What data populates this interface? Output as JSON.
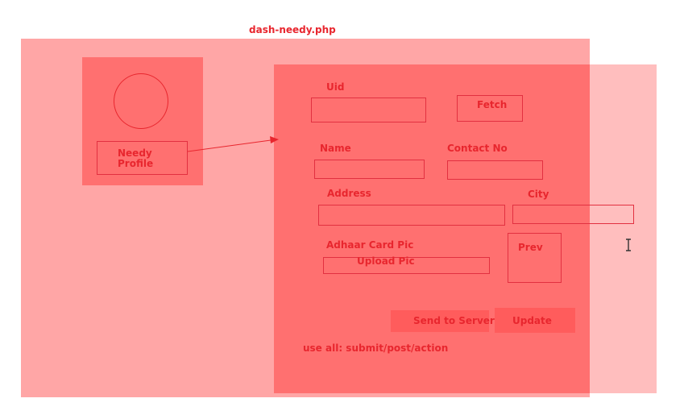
{
  "page": {
    "title": "dash-needy.php"
  },
  "profile": {
    "button_label_line1": "Needy",
    "button_label_line2": "Profile"
  },
  "form": {
    "uid_label": "Uid",
    "fetch_label": "Fetch",
    "name_label": "Name",
    "contact_label": "Contact No",
    "address_label": "Address",
    "city_label": "City",
    "adhaar_label": "Adhaar Card Pic",
    "upload_label": "Upload Pic",
    "preview_label": "Prev",
    "send_label": "Send to Server",
    "update_label": "Update",
    "note": "use all: submit/post/action"
  },
  "colors": {
    "text": "#e8262e",
    "background_panel": "#ffa6a6",
    "main_panel": "#ff7070",
    "button_fill": "#ff5c5c"
  },
  "icons": {
    "cursor": "text-cursor-icon"
  }
}
